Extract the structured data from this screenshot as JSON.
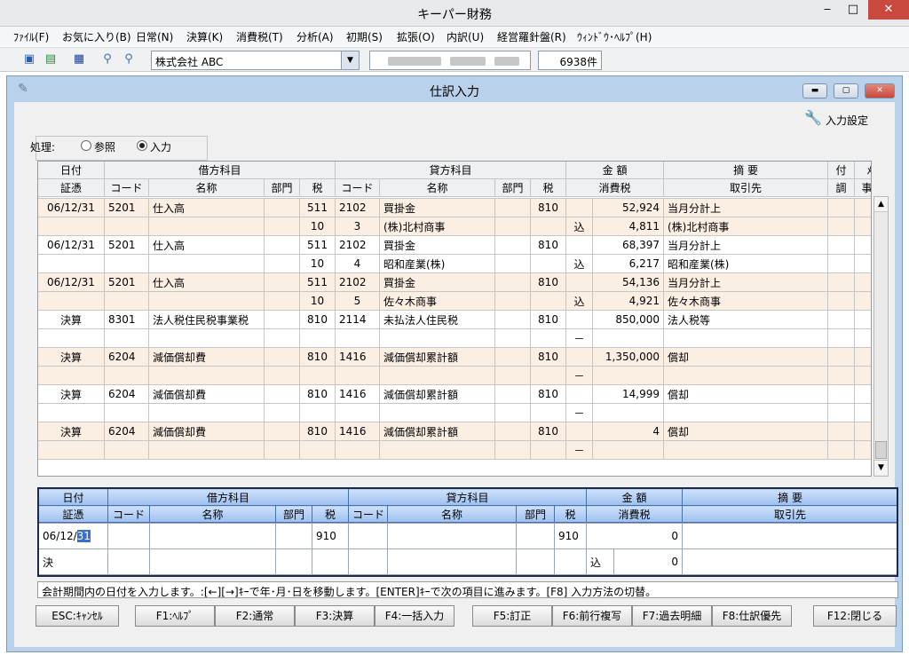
{
  "app": {
    "title": "キーパー財務",
    "minimize": "‒",
    "maximize": "□",
    "close": "✕"
  },
  "menu": [
    "ﾌｧｲﾙ(F)",
    "お気に入り(B)",
    "日常(N)",
    "決算(K)",
    "消費税(T)",
    "分析(A)",
    "初期(S)",
    "拡張(O)",
    "内訳(U)",
    "経営羅針盤(R)",
    "ｳｨﾝﾄﾞｳ･ﾍﾙﾌﾟ(H)"
  ],
  "toolbar": {
    "icons": [
      "save-icon",
      "export-icon",
      "monitor-icon",
      "zoom-in-icon",
      "zoom-out-icon"
    ],
    "company": "株式会社 ABC",
    "count": "6938件"
  },
  "window": {
    "title": "仕訳入力"
  },
  "settings": {
    "label": "入力設定"
  },
  "process": {
    "label": "処理:",
    "options": [
      "参照",
      "入力"
    ],
    "selected": "入力"
  },
  "grid": {
    "header1": [
      "日付",
      "借方科目",
      "貸方科目",
      "金 額",
      "摘 要",
      "付",
      "ﾒﾓ"
    ],
    "header2": [
      "証憑",
      "コード",
      "名称",
      "部門",
      "税",
      "コード",
      "名称",
      "部門",
      "税",
      "消費税",
      "取引先",
      "調",
      "事ﾒﾓ"
    ],
    "rows": [
      {
        "a": [
          "06/12/31",
          "5201",
          "仕入高",
          "",
          "511",
          "2102",
          "買掛金",
          "",
          "810",
          "",
          "52,924",
          "当月分計上"
        ],
        "b": [
          "",
          "",
          "",
          "",
          "10",
          "3",
          "(株)北村商事",
          "",
          "",
          "込",
          "4,811",
          "(株)北村商事"
        ]
      },
      {
        "a": [
          "06/12/31",
          "5201",
          "仕入高",
          "",
          "511",
          "2102",
          "買掛金",
          "",
          "810",
          "",
          "68,397",
          "当月分計上"
        ],
        "b": [
          "",
          "",
          "",
          "",
          "10",
          "4",
          "昭和産業(株)",
          "",
          "",
          "込",
          "6,217",
          "昭和産業(株)"
        ]
      },
      {
        "a": [
          "06/12/31",
          "5201",
          "仕入高",
          "",
          "511",
          "2102",
          "買掛金",
          "",
          "810",
          "",
          "54,136",
          "当月分計上"
        ],
        "b": [
          "",
          "",
          "",
          "",
          "10",
          "5",
          "佐々木商事",
          "",
          "",
          "込",
          "4,921",
          "佐々木商事"
        ]
      },
      {
        "a": [
          "決算",
          "8301",
          "法人税住民税事業税",
          "",
          "810",
          "2114",
          "未払法人住民税",
          "",
          "810",
          "",
          "850,000",
          "法人税等"
        ],
        "b": [
          "",
          "",
          "",
          "",
          "",
          "",
          "",
          "",
          "",
          "－",
          "",
          ""
        ]
      },
      {
        "a": [
          "決算",
          "6204",
          "減価償却費",
          "",
          "810",
          "1416",
          "減価償却累計額",
          "",
          "810",
          "",
          "1,350,000",
          "償却"
        ],
        "b": [
          "",
          "",
          "",
          "",
          "",
          "",
          "",
          "",
          "",
          "－",
          "",
          ""
        ]
      },
      {
        "a": [
          "決算",
          "6204",
          "減価償却費",
          "",
          "810",
          "1416",
          "減価償却累計額",
          "",
          "810",
          "",
          "14,999",
          "償却"
        ],
        "b": [
          "",
          "",
          "",
          "",
          "",
          "",
          "",
          "",
          "",
          "－",
          "",
          ""
        ]
      },
      {
        "a": [
          "決算",
          "6204",
          "減価償却費",
          "",
          "810",
          "1416",
          "減価償却累計額",
          "",
          "810",
          "",
          "4",
          "償却"
        ],
        "b": [
          "",
          "",
          "",
          "",
          "",
          "",
          "",
          "",
          "",
          "－",
          "",
          ""
        ]
      }
    ]
  },
  "entry": {
    "header1": [
      "日付",
      "借方科目",
      "貸方科目",
      "金 額",
      "摘 要"
    ],
    "header2": [
      "証憑",
      "コード",
      "名称",
      "部門",
      "税",
      "コード",
      "名称",
      "部門",
      "税",
      "消費税",
      "取引先"
    ],
    "date_prefix": "06/12/",
    "date_selected": "31",
    "debit_tax": "910",
    "credit_tax": "910",
    "amount": "0",
    "voucher": "決",
    "tax_mode": "込",
    "tax_amount": "0"
  },
  "status": "会計期間内の日付を入力します。:[←][→]ｷｰで年･月･日を移動します。[ENTER]ｷｰで次の項目に進みます。[F8] 入力方法の切替。",
  "fkeys": [
    "ESC:ｷｬﾝｾﾙ",
    "F1:ﾍﾙﾌﾟ",
    "F2:通常",
    "F3:決算",
    "F4:一括入力",
    "F5:訂正",
    "F6:前行複写",
    "F7:過去明細",
    "F8:仕訳優先",
    "F12:閉じる"
  ]
}
